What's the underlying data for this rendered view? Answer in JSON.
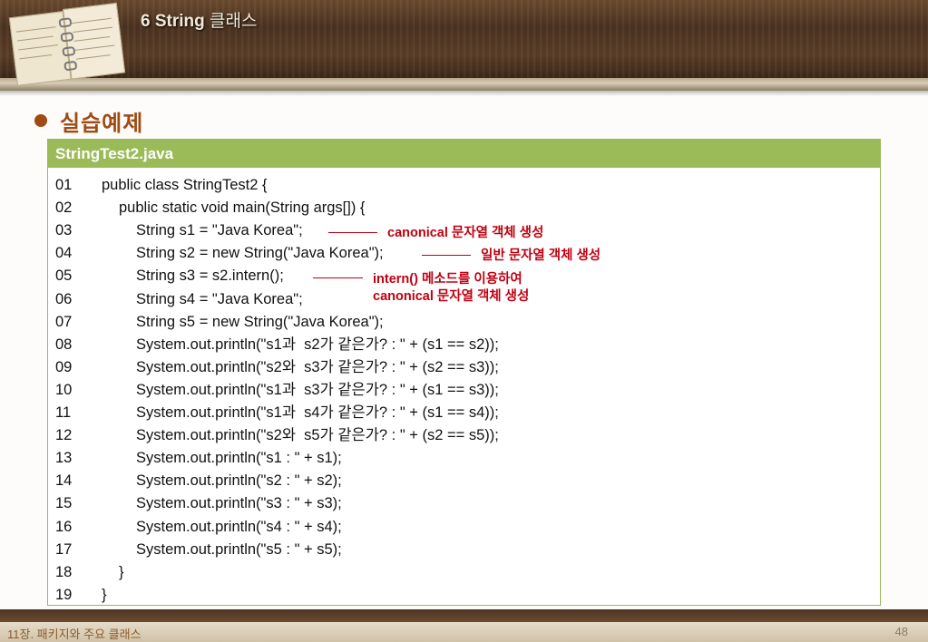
{
  "header": {
    "title_bold": "6 String",
    "title_rest": "클래스"
  },
  "section": {
    "title": "실습예제"
  },
  "panel": {
    "filename": "StringTest2.java",
    "lines": [
      {
        "num": "01",
        "indent": 0,
        "text": "public class StringTest2 {"
      },
      {
        "num": "02",
        "indent": 1,
        "text": "public static void main(String args[]) {"
      },
      {
        "num": "03",
        "indent": 2,
        "text": "String s1 = \"Java Korea\";"
      },
      {
        "num": "04",
        "indent": 2,
        "text": "String s2 = new String(\"Java Korea\");"
      },
      {
        "num": "05",
        "indent": 2,
        "text": "String s3 = s2.intern();"
      },
      {
        "num": "06",
        "indent": 2,
        "text": "String s4 = \"Java Korea\";"
      },
      {
        "num": "07",
        "indent": 2,
        "text": "String s5 = new String(\"Java Korea\");"
      },
      {
        "num": "08",
        "indent": 2,
        "text": "System.out.println(\"s1과  s2가 같은가? : \" + (s1 == s2));"
      },
      {
        "num": "09",
        "indent": 2,
        "text": "System.out.println(\"s2와  s3가 같은가? : \" + (s2 == s3));"
      },
      {
        "num": "10",
        "indent": 2,
        "text": "System.out.println(\"s1과  s3가 같은가? : \" + (s1 == s3));"
      },
      {
        "num": "11",
        "indent": 2,
        "text": "System.out.println(\"s1과  s4가 같은가? : \" + (s1 == s4));"
      },
      {
        "num": "12",
        "indent": 2,
        "text": "System.out.println(\"s2와  s5가 같은가? : \" + (s2 == s5));"
      },
      {
        "num": "13",
        "indent": 2,
        "text": "System.out.println(\"s1 : \" + s1);"
      },
      {
        "num": "14",
        "indent": 2,
        "text": "System.out.println(\"s2 : \" + s2);"
      },
      {
        "num": "15",
        "indent": 2,
        "text": "System.out.println(\"s3 : \" + s3);"
      },
      {
        "num": "16",
        "indent": 2,
        "text": "System.out.println(\"s4 : \" + s4);"
      },
      {
        "num": "17",
        "indent": 2,
        "text": "System.out.println(\"s5 : \" + s5);"
      },
      {
        "num": "18",
        "indent": 1,
        "text": "}"
      },
      {
        "num": "19",
        "indent": 0,
        "text": "}"
      }
    ]
  },
  "annotations": {
    "a1": "canonical 문자열 객체 생성",
    "a2": "일반 문자열 객체 생성",
    "a3_line1": "intern() 메소드를 이용하여",
    "a3_line2": "canonical 문자열 객체 생성"
  },
  "footer": {
    "chapter": "11장. 패키지와 주요 클래스",
    "page": "48"
  },
  "colors": {
    "accent": "#a04a14",
    "panel_header": "#9bbb59",
    "annotation": "#c00010"
  }
}
